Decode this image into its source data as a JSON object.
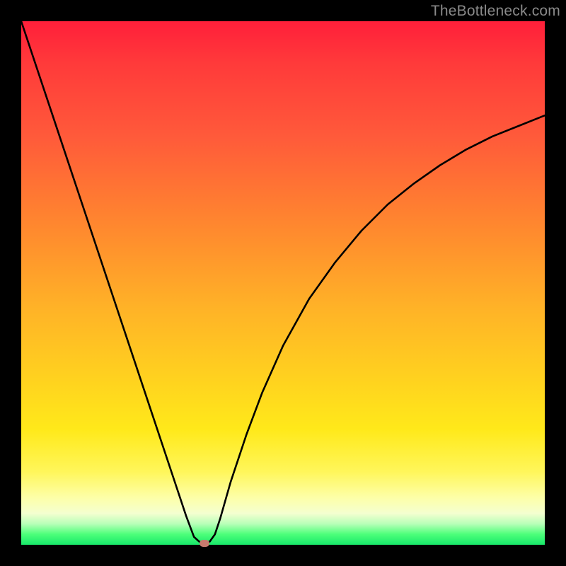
{
  "watermark": "TheBottleneck.com",
  "colors": {
    "frame": "#000000",
    "gradient_top": "#ff1f3a",
    "gradient_mid1": "#ff8a2e",
    "gradient_mid2": "#ffe91a",
    "gradient_bottom": "#18e86a",
    "curve": "#000000",
    "marker": "#c77a6e"
  },
  "chart_data": {
    "type": "line",
    "title": "",
    "xlabel": "",
    "ylabel": "",
    "xlim": [
      0,
      100
    ],
    "ylim": [
      0,
      100
    ],
    "grid": false,
    "legend": false,
    "series": [
      {
        "name": "bottleneck-curve",
        "x": [
          0,
          3,
          6,
          9,
          12,
          15,
          18,
          21,
          24,
          27,
          30,
          31.5,
          33,
          34,
          35,
          36,
          37,
          38,
          40,
          43,
          46,
          50,
          55,
          60,
          65,
          70,
          75,
          80,
          85,
          90,
          95,
          100
        ],
        "y": [
          100,
          91,
          82,
          73,
          64,
          55,
          46,
          37,
          28,
          19,
          10,
          5.5,
          1.5,
          0.6,
          0.3,
          0.6,
          2,
          5,
          12,
          21,
          29,
          38,
          47,
          54,
          60,
          65,
          69,
          72.5,
          75.5,
          78,
          80,
          82
        ]
      }
    ],
    "annotations": [
      {
        "name": "optimal-point-marker",
        "x": 35,
        "y": 0.3
      }
    ]
  }
}
